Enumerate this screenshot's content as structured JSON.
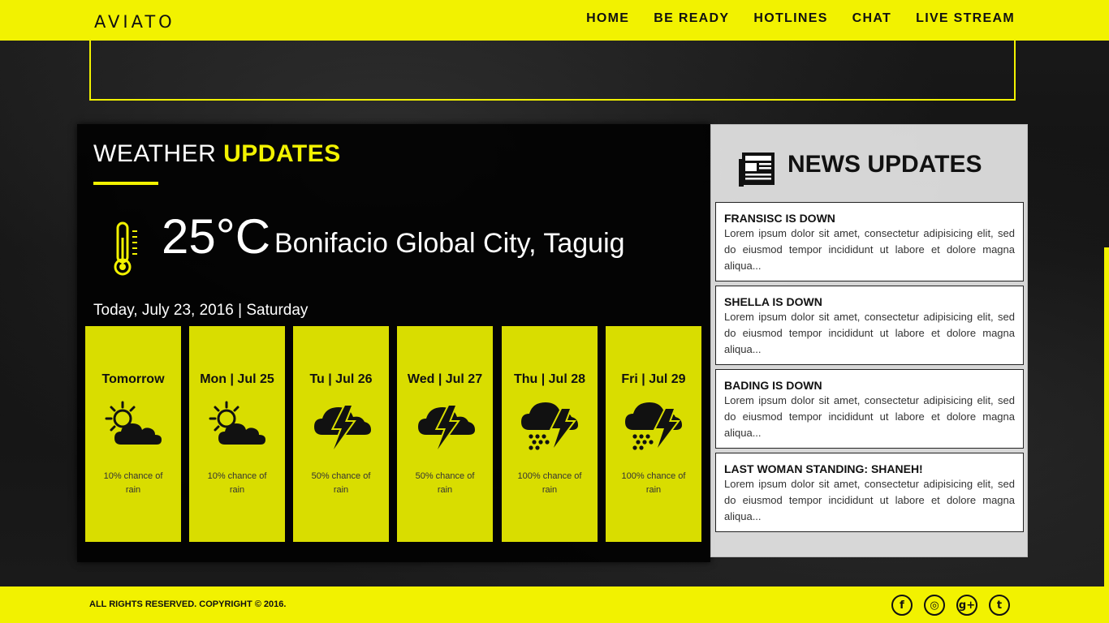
{
  "header": {
    "logo": "AVIATO",
    "nav": [
      "HOME",
      "BE READY",
      "HOTLINES",
      "CHAT",
      "LIVE STREAM"
    ]
  },
  "weather": {
    "title_light": "WEATHER ",
    "title_bold": "UPDATES",
    "temperature": "25°C",
    "location": "Bonifacio Global City, Taguig",
    "today": "Today, July 23, 2016 | Saturday",
    "forecast": [
      {
        "day": "Tomorrow",
        "icon": "partly-cloudy-icon",
        "chance": "10% chance of rain"
      },
      {
        "day": "Mon | Jul 25",
        "icon": "partly-cloudy-icon",
        "chance": "10% chance of rain"
      },
      {
        "day": "Tu | Jul 26",
        "icon": "thunderstorm-icon",
        "chance": "50% chance of rain"
      },
      {
        "day": "Wed | Jul 27",
        "icon": "thunderstorm-icon",
        "chance": "50% chance of rain"
      },
      {
        "day": "Thu | Jul 28",
        "icon": "thunder-rain-icon",
        "chance": "100% chance of rain"
      },
      {
        "day": "Fri | Jul 29",
        "icon": "thunder-rain-icon",
        "chance": "100% chance of rain"
      }
    ]
  },
  "news": {
    "title_light": "NEWS ",
    "title_bold": "UPDATES",
    "items": [
      {
        "title": "FRANSISC IS DOWN",
        "body": "Lorem ipsum dolor sit amet, consectetur adipisicing elit, sed do eiusmod tempor incididunt ut labore et dolore magna aliqua..."
      },
      {
        "title": "SHELLA IS DOWN",
        "body": "Lorem ipsum dolor sit amet, consectetur adipisicing elit, sed do eiusmod tempor incididunt ut labore et dolore magna aliqua..."
      },
      {
        "title": "BADING IS DOWN",
        "body": "Lorem ipsum dolor sit amet, consectetur adipisicing elit, sed do eiusmod tempor incididunt ut labore et dolore magna aliqua..."
      },
      {
        "title": "LAST WOMAN STANDING: SHANEH!",
        "body": "Lorem ipsum dolor sit amet, consectetur adipisicing elit, sed do eiusmod tempor incididunt ut labore et dolore magna aliqua..."
      }
    ]
  },
  "footer": {
    "copyright": "ALL RIGHTS RESERVED. COPYRIGHT © 2016.",
    "socials": [
      {
        "name": "facebook-icon",
        "glyph": "f"
      },
      {
        "name": "dribbble-icon",
        "glyph": "◎"
      },
      {
        "name": "google-plus-icon",
        "glyph": "g+"
      },
      {
        "name": "twitter-icon",
        "glyph": "t"
      }
    ]
  },
  "colors": {
    "accent": "#f2f200",
    "card": "#d9dd00"
  }
}
